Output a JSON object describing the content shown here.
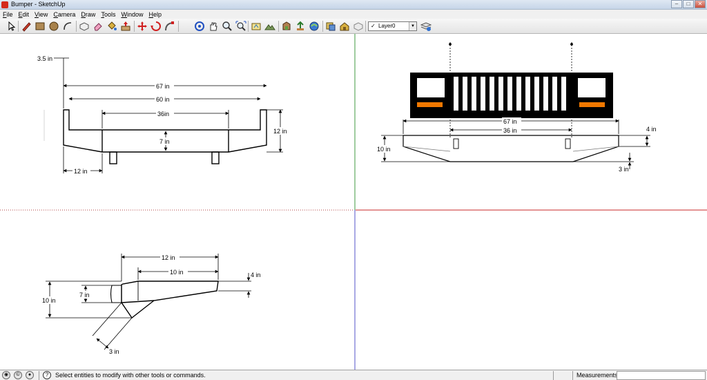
{
  "window": {
    "title": "Bumper - SketchUp",
    "buttons": [
      "–",
      "□",
      "✕"
    ]
  },
  "menu": [
    "File",
    "Edit",
    "View",
    "Camera",
    "Draw",
    "Tools",
    "Window",
    "Help"
  ],
  "toolbar": {
    "tools": [
      "select-tool-icon",
      "pencil-icon",
      "rectangle-icon",
      "circle-icon",
      "arc-icon",
      "make-component-icon",
      "eraser-icon",
      "paint-bucket-icon",
      "push-pull-icon",
      "move-icon",
      "rotate-icon",
      "follow-me-icon",
      "orbit-icon",
      "pan-icon",
      "zoom-icon",
      "zoom-extents-icon",
      "add-location-icon",
      "toggle-terrain-icon",
      "get-models-icon",
      "share-model-icon",
      "get-photo-texture-icon",
      "share-component-icon",
      "3d-warehouse-icon",
      "preview-in-google-earth-icon",
      "layer-manager-icon"
    ],
    "layer": {
      "checked": "✓",
      "value": "Layer0"
    }
  },
  "views": {
    "top_left": {
      "dimensions": [
        "3.5 in",
        "67 in",
        "60 in",
        "36in",
        "7 in",
        "12 in",
        "12 in"
      ]
    },
    "top_right": {
      "dimensions": [
        "67 in",
        "36 in",
        "4 in",
        "10 in",
        "3 in"
      ]
    },
    "bottom_left": {
      "dimensions": [
        "12 in",
        "10 in",
        "4 in",
        "10 in",
        "7 in",
        "3 in"
      ]
    }
  },
  "status": {
    "message": "Select entities to modify with other tools or commands.",
    "measurements_label": "Measurements",
    "measurements_value": ""
  },
  "colors": {
    "axis_green": "#3c9a3c",
    "axis_red": "#c82828",
    "axis_blue": "#5050c8",
    "light_orange": "#f07800"
  }
}
